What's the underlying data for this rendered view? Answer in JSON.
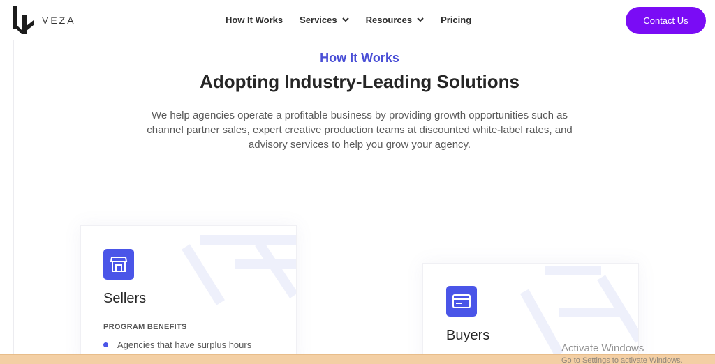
{
  "brand": {
    "name": "VEZA"
  },
  "nav": {
    "items": [
      {
        "label": "How It Works",
        "has_dropdown": false
      },
      {
        "label": "Services",
        "has_dropdown": true
      },
      {
        "label": "Resources",
        "has_dropdown": true
      },
      {
        "label": "Pricing",
        "has_dropdown": false
      }
    ],
    "cta_label": "Contact Us"
  },
  "hero": {
    "eyebrow": "How It Works",
    "title": "Adopting Industry-Leading Solutions",
    "description": "We help agencies operate a profitable business by providing growth opportunities such as channel partner sales, expert creative production teams at discounted white-label rates, and advisory services to help you grow your agency."
  },
  "cards": {
    "sellers": {
      "icon": "storefront-icon",
      "title": "Sellers",
      "benefits_label": "PROGRAM BENEFITS",
      "benefits": [
        "Agencies that have surplus hours"
      ]
    },
    "buyers": {
      "icon": "credit-card-icon",
      "title": "Buyers"
    }
  },
  "os_overlay": {
    "title": "Activate Windows",
    "subtitle": "Go to Settings to activate Windows."
  },
  "colors": {
    "accent": "#4a4fd6",
    "cta": "#7a0cf5",
    "icon_bg": "#4a55e8",
    "taskbar": "#f3cfa4"
  }
}
